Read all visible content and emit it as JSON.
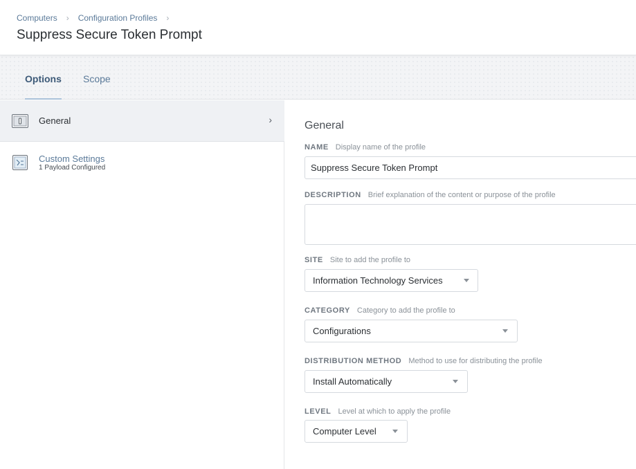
{
  "breadcrumb": {
    "items": [
      "Computers",
      "Configuration Profiles"
    ],
    "separator": "›"
  },
  "page": {
    "title": "Suppress Secure Token Prompt"
  },
  "tabs": [
    {
      "label": "Options",
      "active": true
    },
    {
      "label": "Scope",
      "active": false
    }
  ],
  "sidebar": {
    "items": [
      {
        "label": "General",
        "icon": "general-payload-icon",
        "selected": true,
        "chevron": "›"
      },
      {
        "label": "Custom Settings",
        "sublabel": "1 Payload Configured",
        "icon": "custom-settings-icon",
        "selected": false
      }
    ]
  },
  "general": {
    "section_title": "General",
    "name": {
      "label": "NAME",
      "hint": "Display name of the profile",
      "value": "Suppress Secure Token Prompt"
    },
    "description": {
      "label": "DESCRIPTION",
      "hint": "Brief explanation of the content or purpose of the profile",
      "value": ""
    },
    "site": {
      "label": "SITE",
      "hint": "Site to add the profile to",
      "value": "Information Technology Services"
    },
    "category": {
      "label": "CATEGORY",
      "hint": "Category to add the profile to",
      "value": "Configurations"
    },
    "distribution": {
      "label": "DISTRIBUTION METHOD",
      "hint": "Method to use for distributing the profile",
      "value": "Install Automatically"
    },
    "level": {
      "label": "LEVEL",
      "hint": "Level at which to apply the profile",
      "value": "Computer Level"
    }
  },
  "colors": {
    "link": "#5b7a99",
    "tab_underline": "#a9c1d9",
    "selected_bg": "#eff1f4"
  }
}
